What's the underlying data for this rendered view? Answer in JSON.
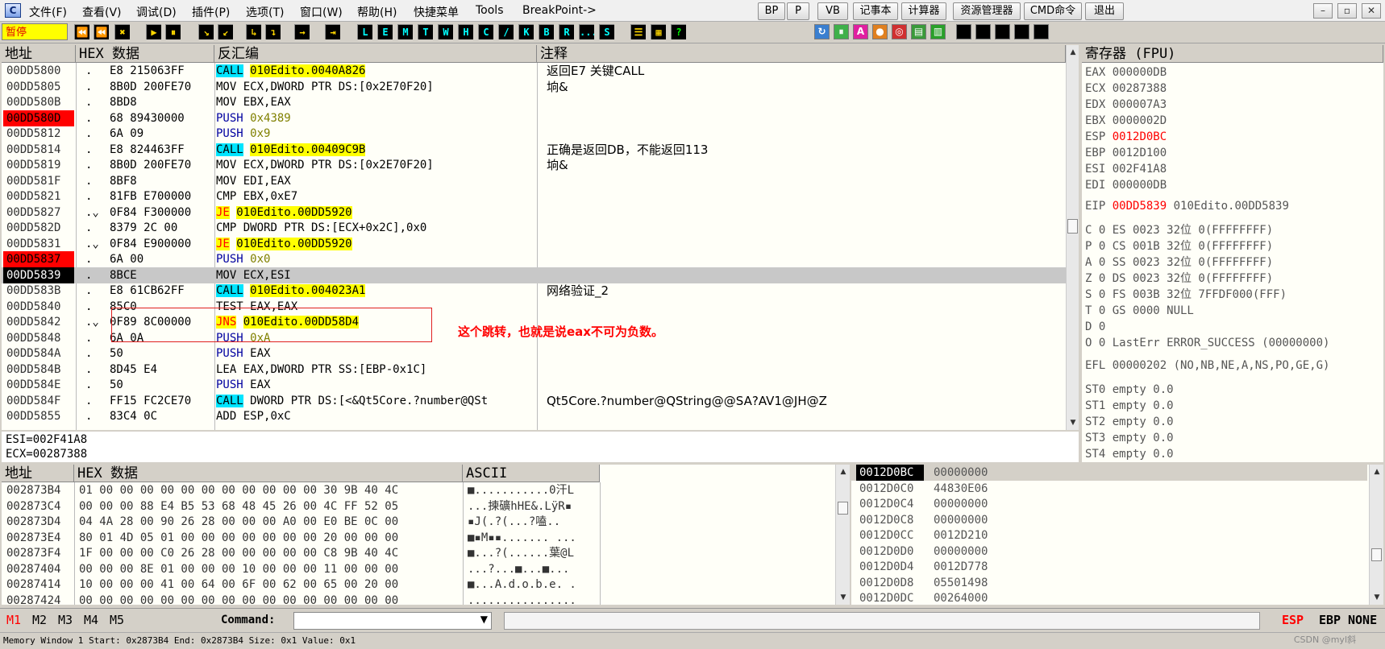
{
  "menu": {
    "items": [
      "文件(F)",
      "查看(V)",
      "调试(D)",
      "插件(P)",
      "选项(T)",
      "窗口(W)",
      "帮助(H)",
      "快捷菜单",
      "Tools",
      "BreakPoint->"
    ],
    "buttons": [
      "BP",
      "P",
      "VB",
      "记事本",
      "计算器",
      "资源管理器",
      "CMD命令",
      "退出"
    ],
    "logo": "C"
  },
  "window_controls": {
    "min": "–",
    "restore": "▫",
    "close": "✕"
  },
  "toolbar": {
    "status": "暂停",
    "debug_buttons": [
      "▶",
      "⏪",
      "✖",
      "▶",
      "⏸",
      "↘",
      "↙",
      "↳",
      "↴",
      "→",
      "⇥"
    ],
    "view_buttons": [
      "L",
      "E",
      "M",
      "T",
      "W",
      "H",
      "C",
      "/",
      "K",
      "B",
      "R",
      "...",
      "S"
    ],
    "misc_buttons": [
      "☰",
      "▦",
      "?"
    ],
    "right_icons": [
      "↻",
      "⏸",
      "A",
      "●",
      "◎",
      "▤",
      "▥"
    ]
  },
  "disasm": {
    "headers": {
      "addr": "地址",
      "hex": "HEX 数据",
      "dis": "反汇编",
      "comment": "注释"
    },
    "rows": [
      {
        "addr": "00DD5800",
        "mark": ".",
        "hex": "E8 215063FF",
        "op": "CALL",
        "args": "010Edito.0040A826",
        "comment": "返回E7 关键CALL"
      },
      {
        "addr": "00DD5805",
        "mark": ".",
        "hex": "8B0D 200FE70",
        "op": "MOV",
        "args": "ECX,DWORD PTR DS:[0x2E70F20]",
        "comment": "垧&"
      },
      {
        "addr": "00DD580B",
        "mark": ".",
        "hex": "8BD8",
        "op": "MOV",
        "args": "EBX,EAX",
        "comment": ""
      },
      {
        "addr": "00DD580D",
        "mark": ".",
        "hex": "68 89430000",
        "op": "PUSH",
        "args": "0x4389",
        "comment": ""
      },
      {
        "addr": "00DD5812",
        "mark": ".",
        "hex": "6A 09",
        "op": "PUSH",
        "args": "0x9",
        "comment": ""
      },
      {
        "addr": "00DD5814",
        "mark": ".",
        "hex": "E8 824463FF",
        "op": "CALL",
        "args": "010Edito.00409C9B",
        "comment": "正确是返回DB，不能返回113"
      },
      {
        "addr": "00DD5819",
        "mark": ".",
        "hex": "8B0D 200FE70",
        "op": "MOV",
        "args": "ECX,DWORD PTR DS:[0x2E70F20]",
        "comment": "垧&"
      },
      {
        "addr": "00DD581F",
        "mark": ".",
        "hex": "8BF8",
        "op": "MOV",
        "args": "EDI,EAX",
        "comment": ""
      },
      {
        "addr": "00DD5821",
        "mark": ".",
        "hex": "81FB E700000",
        "op": "CMP",
        "args": "EBX,0xE7",
        "comment": ""
      },
      {
        "addr": "00DD5827",
        "mark": ".⌄",
        "hex": "0F84 F300000",
        "op": "JE",
        "args": "010Edito.00DD5920",
        "comment": ""
      },
      {
        "addr": "00DD582D",
        "mark": ".",
        "hex": "8379 2C 00",
        "op": "CMP",
        "args": "DWORD PTR DS:[ECX+0x2C],0x0",
        "comment": ""
      },
      {
        "addr": "00DD5831",
        "mark": ".⌄",
        "hex": "0F84 E900000",
        "op": "JE",
        "args": "010Edito.00DD5920",
        "comment": ""
      },
      {
        "addr": "00DD5837",
        "mark": ".",
        "hex": "6A 00",
        "op": "PUSH",
        "args": "0x0",
        "comment": ""
      },
      {
        "addr": "00DD5839",
        "mark": ".",
        "hex": "8BCE",
        "op": "MOV",
        "args": "ECX,ESI",
        "comment": ""
      },
      {
        "addr": "00DD583B",
        "mark": ".",
        "hex": "E8 61CB62FF",
        "op": "CALL",
        "args": "010Edito.004023A1",
        "comment": "网络验证_2"
      },
      {
        "addr": "00DD5840",
        "mark": ".",
        "hex": "85C0",
        "op": "TEST",
        "args": "EAX,EAX",
        "comment": ""
      },
      {
        "addr": "00DD5842",
        "mark": ".⌄",
        "hex": "0F89 8C00000",
        "op": "JNS",
        "args": "010Edito.00DD58D4",
        "comment": ""
      },
      {
        "addr": "00DD5848",
        "mark": ".",
        "hex": "6A 0A",
        "op": "PUSH",
        "args": "0xA",
        "comment": ""
      },
      {
        "addr": "00DD584A",
        "mark": ".",
        "hex": "50",
        "op": "PUSH",
        "args": "EAX",
        "comment": ""
      },
      {
        "addr": "00DD584B",
        "mark": ".",
        "hex": "8D45 E4",
        "op": "LEA",
        "args": "EAX,DWORD PTR SS:[EBP-0x1C]",
        "comment": ""
      },
      {
        "addr": "00DD584E",
        "mark": ".",
        "hex": "50",
        "op": "PUSH",
        "args": "EAX",
        "comment": ""
      },
      {
        "addr": "00DD584F",
        "mark": ".",
        "hex": "FF15 FC2CE70",
        "op": "CALL",
        "args": "DWORD PTR DS:[<&Qt5Core.?number@QSt",
        "comment": "Qt5Core.?number@QString@@SA?AV1@JH@Z"
      },
      {
        "addr": "00DD5855",
        "mark": ".",
        "hex": "83C4 0C",
        "op": "ADD",
        "args": "ESP,0xC",
        "comment": ""
      }
    ],
    "annotation": "这个跳转，也就是说eax不可为负数。"
  },
  "info": {
    "line1": "ESI=002F41A8",
    "line2": "ECX=00287388"
  },
  "registers": {
    "header": "寄存器 (FPU)",
    "gp": [
      [
        "EAX",
        "000000DB"
      ],
      [
        "ECX",
        "00287388"
      ],
      [
        "EDX",
        "000007A3"
      ],
      [
        "EBX",
        "0000002D"
      ],
      [
        "ESP",
        "0012D0BC"
      ],
      [
        "EBP",
        "0012D100"
      ],
      [
        "ESI",
        "002F41A8"
      ],
      [
        "EDI",
        "000000DB"
      ]
    ],
    "eip": {
      "name": "EIP",
      "value": "00DD5839",
      "label": "010Edito.00DD5839"
    },
    "flags": [
      "C 0  ES 0023 32位 0(FFFFFFFF)",
      "P 0  CS 001B 32位 0(FFFFFFFF)",
      "A 0  SS 0023 32位 0(FFFFFFFF)",
      "Z 0  DS 0023 32位 0(FFFFFFFF)",
      "S 0  FS 003B 32位 7FFDF000(FFF)",
      "T 0  GS 0000 NULL",
      "D 0",
      "O 0  LastErr ERROR_SUCCESS (00000000)"
    ],
    "efl": "EFL 00000202 (NO,NB,NE,A,NS,PO,GE,G)",
    "fpu": [
      "ST0 empty 0.0",
      "ST1 empty 0.0",
      "ST2 empty 0.0",
      "ST3 empty 0.0",
      "ST4 empty 0.0"
    ]
  },
  "dump": {
    "headers": {
      "addr": "地址",
      "hex": "HEX 数据",
      "ascii": "ASCII"
    },
    "rows": [
      {
        "addr": "002873B4",
        "hex": "01 00 00 00 00 00 00 00 00 00 00 00 30 9B 40 4C",
        "ascii": "■...........0汗L"
      },
      {
        "addr": "002873C4",
        "hex": "00 00 00 88 E4 B5 53 68 48 45 26 00 4C FF 52 05",
        "ascii": "...揀礦hHE&.LÿR▪"
      },
      {
        "addr": "002873D4",
        "hex": "04 4A 28 00 90 26 28 00 00 00 A0 00 E0 BE 0C 00",
        "ascii": "▪J(.?(...?嗑.."
      },
      {
        "addr": "002873E4",
        "hex": "80 01 4D 05 01 00 00 00 00 00 00 00 20 00 00 00",
        "ascii": "■▪M▪▪....... ..."
      },
      {
        "addr": "002873F4",
        "hex": "1F 00 00 00 C0 26 28 00 00 00 00 00 C8 9B 40 4C",
        "ascii": "■...?(......葉@L"
      },
      {
        "addr": "00287404",
        "hex": "00 00 00 8E 01 00 00 00 10 00 00 00 11 00 00 00",
        "ascii": "...?...■...■..."
      },
      {
        "addr": "00287414",
        "hex": "10 00 00 00 41 00 64 00 6F 00 62 00 65 00 20 00",
        "ascii": "■...A.d.o.b.e. ."
      },
      {
        "addr": "00287424",
        "hex": "00 00 00 00 00 00 00 00 00 00 00 00 00 00 00 00",
        "ascii": "................"
      }
    ]
  },
  "stack": {
    "rows": [
      {
        "addr": "0012D0BC",
        "val": "00000000"
      },
      {
        "addr": "0012D0C0",
        "val": "44830E06"
      },
      {
        "addr": "0012D0C4",
        "val": "00000000"
      },
      {
        "addr": "0012D0C8",
        "val": "00000000"
      },
      {
        "addr": "0012D0CC",
        "val": "0012D210"
      },
      {
        "addr": "0012D0D0",
        "val": "00000000"
      },
      {
        "addr": "0012D0D4",
        "val": "0012D778"
      },
      {
        "addr": "0012D0D8",
        "val": "05501498"
      },
      {
        "addr": "0012D0DC",
        "val": "00264000"
      }
    ]
  },
  "cmd": {
    "tabs": [
      "M1",
      "M2",
      "M3",
      "M4",
      "M5"
    ],
    "label": "Command:",
    "value": "",
    "regs": [
      "ESP",
      "EBP",
      "NONE"
    ]
  },
  "status": {
    "text": "Memory Window 1  Start: 0x2873B4  End: 0x2873B4  Size: 0x1 Value: 0x1",
    "watermark": "CSDN @myl斜"
  },
  "colors": {
    "bp": "#ff0000",
    "call": "#00e5ff",
    "jump": "#ffff00",
    "annotation": "#ff0000"
  }
}
